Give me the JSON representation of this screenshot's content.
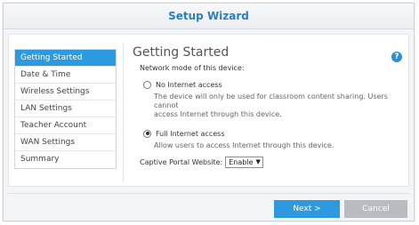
{
  "window": {
    "title": "Setup Wizard"
  },
  "sidebar": {
    "items": [
      {
        "label": "Getting Started",
        "active": true
      },
      {
        "label": "Date & Time"
      },
      {
        "label": "Wireless Settings"
      },
      {
        "label": "LAN Settings"
      },
      {
        "label": "Teacher Account"
      },
      {
        "label": "WAN Settings"
      },
      {
        "label": "Summary"
      }
    ]
  },
  "main": {
    "heading": "Getting Started",
    "help_icon": "?",
    "network_mode_label": "Network mode of this device:",
    "options": [
      {
        "label": "No Internet access",
        "checked": false,
        "description_lines": [
          "The device will only be used for classroom content sharing. Users cannot",
          "access Internet through this device."
        ]
      },
      {
        "label": "Full Internet access",
        "checked": true,
        "description_lines": [
          "Allow users to access Internet through this device."
        ]
      }
    ],
    "captive_portal": {
      "label": "Captive Portal Website:",
      "value": "Enable"
    }
  },
  "footer": {
    "next_label": "Next >",
    "cancel_label": "Cancel"
  },
  "colors": {
    "accent": "#2d9ae0",
    "title": "#2a7fc4",
    "cancel": "#b8bcc1"
  }
}
